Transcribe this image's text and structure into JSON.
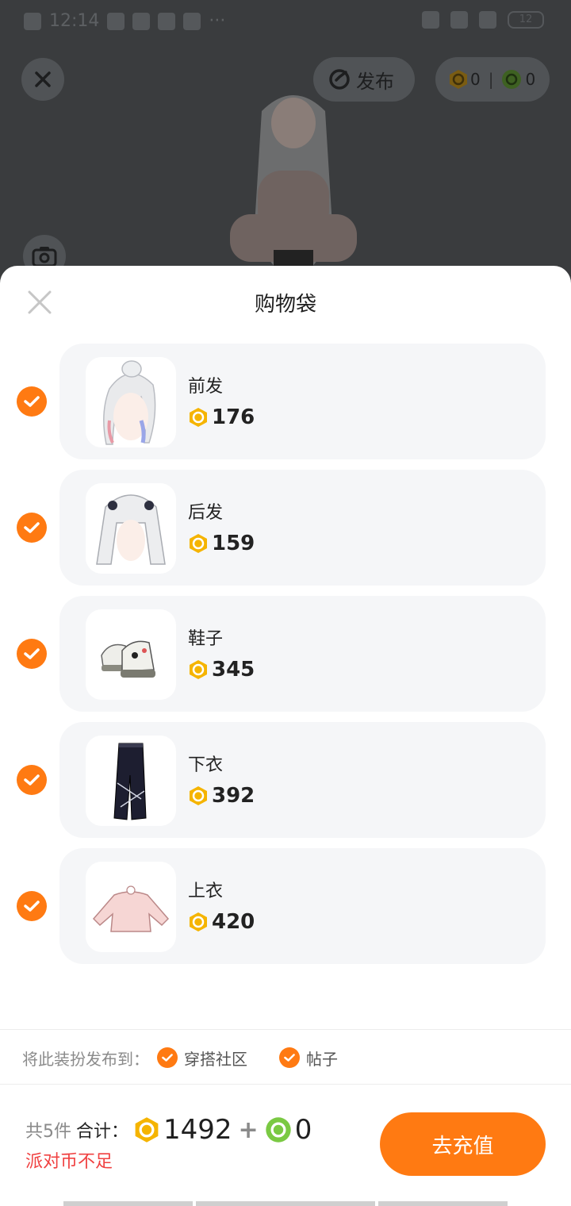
{
  "status_bar": {
    "time": "12:14",
    "battery": "12"
  },
  "top_bar": {
    "publish_label": "发布",
    "coin_gold_count": "0",
    "coin_green_count": "0"
  },
  "sheet": {
    "title": "购物袋",
    "items": [
      {
        "name": "前发",
        "price": "176"
      },
      {
        "name": "后发",
        "price": "159"
      },
      {
        "name": "鞋子",
        "price": "345"
      },
      {
        "name": "下衣",
        "price": "392"
      },
      {
        "name": "上衣",
        "price": "420"
      }
    ],
    "publish_to_label": "将此装扮发布到：",
    "publish_options": [
      "穿搭社区",
      "帖子"
    ]
  },
  "footer": {
    "count_label": "共5件",
    "total_label": "合计：",
    "total_gold": "1492",
    "plus": "+",
    "total_green": "0",
    "warning": "派对币不足",
    "recharge_label": "去充值"
  },
  "colors": {
    "accent": "#ff7a12",
    "warning": "#f04141",
    "card_bg": "#f5f6f8",
    "gold_coin": "#f5b400",
    "green_coin": "#7ac943"
  },
  "icons": [
    "close-icon",
    "publish-icon",
    "gold-coin-icon",
    "green-coin-icon",
    "camera-icon",
    "checkmark-icon"
  ]
}
